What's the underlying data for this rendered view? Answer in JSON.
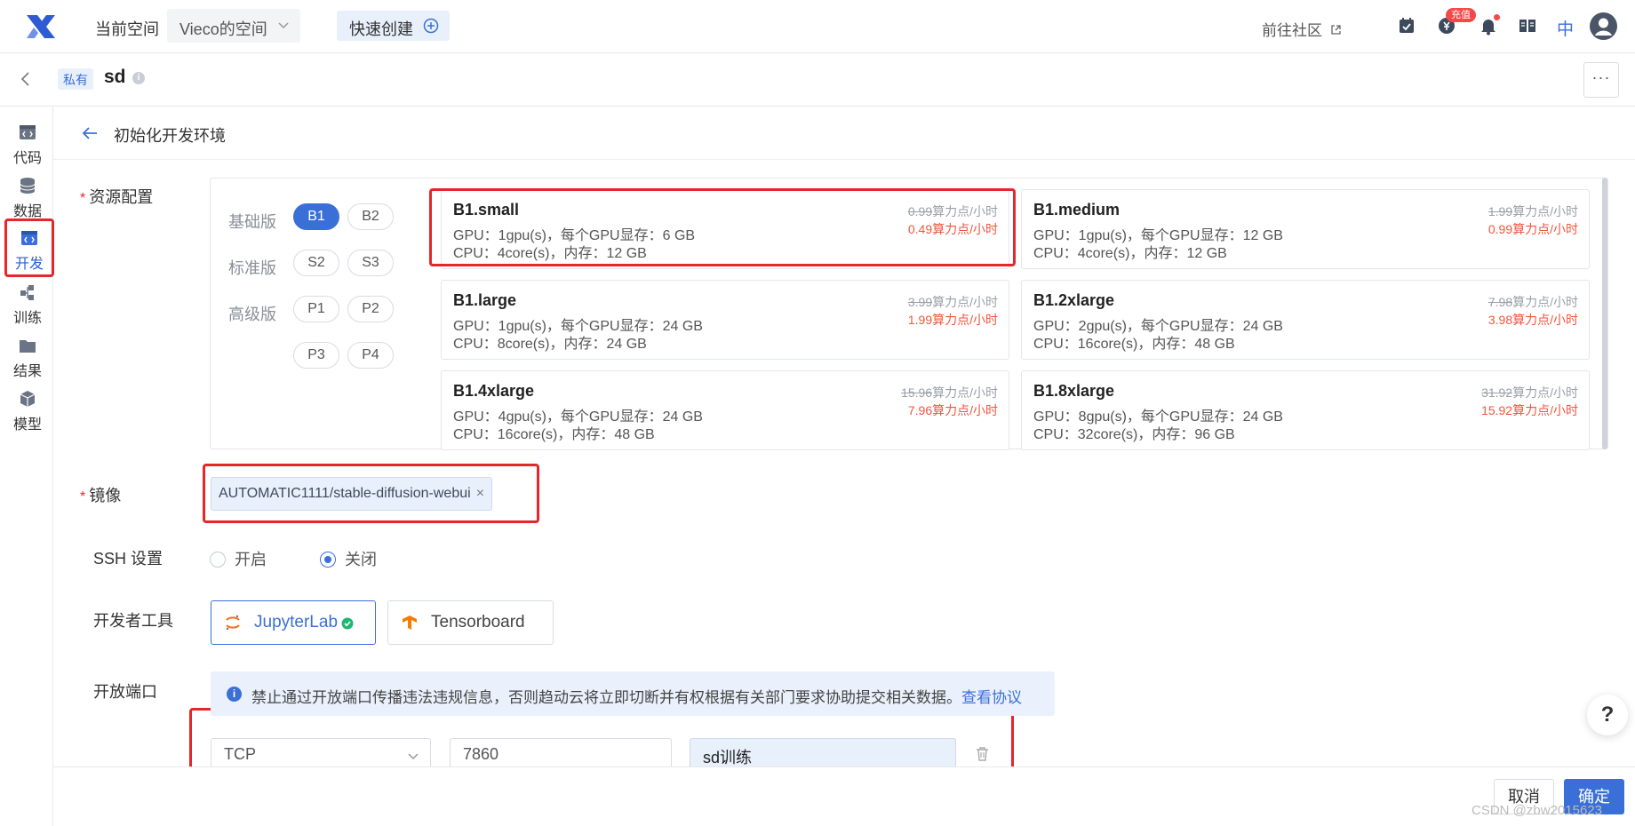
{
  "header": {
    "workspace_label": "当前空间",
    "workspace_value": "Vieco的空间",
    "quick_create": "快速创建",
    "community": "前往社区",
    "recharge_badge": "充值",
    "lang": "中"
  },
  "subheader": {
    "visibility_tag": "私有",
    "project_name": "sd"
  },
  "sidebar": {
    "items": [
      {
        "label": "代码"
      },
      {
        "label": "数据"
      },
      {
        "label": "开发"
      },
      {
        "label": "训练"
      },
      {
        "label": "结果"
      },
      {
        "label": "模型"
      }
    ],
    "active": "开发"
  },
  "page": {
    "title": "初始化开发环境"
  },
  "resource": {
    "label": "资源配置",
    "tiers": [
      {
        "name": "基础版",
        "options": [
          "B1",
          "B2"
        ]
      },
      {
        "name": "标准版",
        "options": [
          "S2",
          "S3"
        ]
      },
      {
        "name": "高级版",
        "options": [
          "P1",
          "P2",
          "P3",
          "P4"
        ]
      }
    ],
    "selected_option": "B1",
    "specs": [
      {
        "name": "B1.small",
        "gpu": "GPU：1gpu(s)，每个GPU显存：6 GB",
        "cpu": "CPU：4core(s)，内存：12 GB",
        "old_price": "0.99",
        "new_price": "0.49算力点/小时"
      },
      {
        "name": "B1.medium",
        "gpu": "GPU：1gpu(s)，每个GPU显存：12 GB",
        "cpu": "CPU：4core(s)，内存：12 GB",
        "old_price": "1.99",
        "new_price": "0.99算力点/小时"
      },
      {
        "name": "B1.large",
        "gpu": "GPU：1gpu(s)，每个GPU显存：24 GB",
        "cpu": "CPU：8core(s)，内存：24 GB",
        "old_price": "3.99",
        "new_price": "1.99算力点/小时"
      },
      {
        "name": "B1.2xlarge",
        "gpu": "GPU：2gpu(s)，每个GPU显存：24 GB",
        "cpu": "CPU：16core(s)，内存：48 GB",
        "old_price": "7.98",
        "new_price": "3.98算力点/小时"
      },
      {
        "name": "B1.4xlarge",
        "gpu": "GPU：4gpu(s)，每个GPU显存：24 GB",
        "cpu": "CPU：16core(s)，内存：48 GB",
        "old_price": "15.96",
        "new_price": "7.96算力点/小时"
      },
      {
        "name": "B1.8xlarge",
        "gpu": "GPU：8gpu(s)，每个GPU显存：24 GB",
        "cpu": "CPU：32core(s)，内存：96 GB",
        "old_price": "31.92",
        "new_price": "15.92算力点/小时"
      }
    ],
    "price_unit": "算力点/小时",
    "selected_spec": "B1.small"
  },
  "image": {
    "label": "镜像",
    "value": "AUTOMATIC1111/stable-diffusion-webui",
    "remove": "×"
  },
  "ssh": {
    "label": "SSH 设置",
    "on": "开启",
    "off": "关闭",
    "selected": "关闭"
  },
  "tools": {
    "label": "开发者工具",
    "items": [
      "JupyterLab",
      "Tensorboard"
    ],
    "selected": "JupyterLab"
  },
  "ports": {
    "label": "开放端口",
    "notice": "禁止通过开放端口传播违法违规信息，否则趋动云将立即切断并有权根据有关部门要求协助提交相关数据。",
    "notice_link": "查看协议",
    "protocol": "TCP",
    "port": "7860",
    "name": "sd训练"
  },
  "footer": {
    "cancel": "取消",
    "confirm": "确定",
    "help": "?",
    "watermark": "CSDN @zbw2015623"
  },
  "colors": {
    "primary": "#3b6fd8",
    "highlight": "#e5262b",
    "price": "#f0553d"
  }
}
